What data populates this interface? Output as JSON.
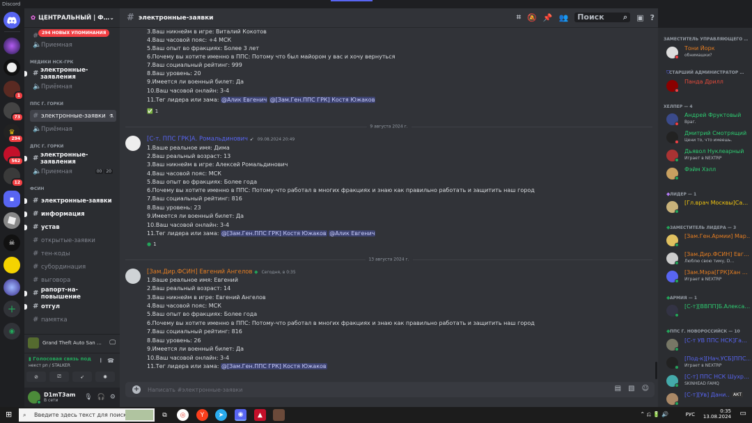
{
  "app": {
    "title": "Discord"
  },
  "guilds": [
    {
      "badge": ""
    },
    {
      "badge": ""
    },
    {
      "badge": ""
    },
    {
      "badge": "1"
    },
    {
      "badge": "73"
    },
    {
      "badge": "294"
    },
    {
      "badge": "562"
    },
    {
      "badge": "12"
    }
  ],
  "server": {
    "name": "ЦЕНТРАЛЬНЫЙ | Ф…",
    "mentions": "294 НОВЫХ УПОМИНАНИЯ"
  },
  "channels": {
    "priemnaya1": "Приемная",
    "cat_medics": "МЕДИКИ НСК-ГРК",
    "med_apps": "электронные-заявления",
    "med_priem": "Приёмная",
    "cat_pps": "ППС Г. ГОРКИ",
    "pps_apps": "электронные-заявки",
    "pps_priem": "Приёмная",
    "cat_dps": "ДПС Г. ГОРКИ",
    "dps_apps": "электронные-заявления",
    "dps_priem": "Приемная",
    "dps_vc": [
      "00",
      "20"
    ],
    "cat_fsin": "ФСИН",
    "fsin_list": [
      "электронные-заявки",
      "информация",
      "устав",
      "открытые-заявки",
      "тен-коды",
      "субординация",
      "выговора",
      "рапорт-на-повышение",
      "отгул",
      "памятка"
    ]
  },
  "activity": {
    "game": "Grand Theft Auto San …"
  },
  "voice": {
    "status": "Голосовая связь под",
    "channel": "некст рп / STALKER"
  },
  "user": {
    "name": "D1mT3am",
    "status": "В сети"
  },
  "topbar": {
    "channel": "электронные-заявки",
    "search_placeholder": "Поиск"
  },
  "messages": [
    {
      "lines": [
        "3.Ваш никнейм в игре:  Виталий Кокотов",
        "4.Ваш часовой пояс:  +4 МСК",
        "5.Ваш опыт во фракциях:  Более 3 лет",
        "6.Почему вы хотите именно в ППС: Потому что был майором у вас и хочу вернуться",
        "7.Ваш социальный рейтинг:  999",
        "8.Ваш уровень: 20",
        "9.Имеется ли военный билет:  Да",
        "10.Ваш часовой онлайн: 3-4"
      ],
      "tag_prefix": "11.Тег лидера или зама: ",
      "tags": [
        "@Алик Евгенич",
        "@[Зам.Ген.ППС ГРК] Костя Южаков"
      ],
      "reaction": "✅",
      "reaction_count": "1"
    },
    {
      "divider": "9 августа 2024 г.",
      "author": "[С-т. ППС ГРК]А. Ромальдинович",
      "time": "09.08.2024 20:49",
      "lines": [
        "1.Ваше реальное имя: Дима",
        "2.Ваш реальный возраст:  13",
        "3.Ваш никнейм в игре:  Алексей Ромальдинович",
        "4.Ваш часовой пояс:  МСК",
        "5.Ваш опыт во фракциях:  Более  года",
        "6.Почему вы хотите именно в ППС: Потому-что работал в многих фракциях и знаю как правильно работать и защитить наш город",
        "7.Ваш социальный рейтинг:  816",
        "8.Ваш уровень: 23",
        "9.Имеется ли военный билет:  Да",
        "10.Ваш часовой онлайн: 3-4"
      ],
      "tag_prefix": "11.Тег лидера или зама: ",
      "tags": [
        "@[Зам.Ген.ППС ГРК] Костя Южаков",
        "@Алик Евгенич"
      ],
      "reaction": "✅",
      "reaction_count": "1"
    },
    {
      "divider": "13 августа 2024 г.",
      "author": "[Зам.Дир.ФСИН] Евгений Ангелов",
      "time": "Сегодня, в 0:35",
      "lines": [
        "1.Ваше реальное имя: Евгений",
        "2.Ваш реальный возраст:  14",
        "3.Ваш никнейм в игре:  Евгений Ангелов",
        "4.Ваш часовой пояс:  МСК",
        "5.Ваш опыт во фракциях:  Более  года",
        "6.Почему вы хотите именно в ППС: Потому-что работал в многих фракциях и знаю как правильно работать и защитить наш город",
        "7.Ваш социальный рейтинг:  816",
        "8.Ваш уровень: 26",
        "9.Имеется ли военный билет:  Да",
        "10.Ваш часовой онлайн: 3-4"
      ],
      "tag_prefix": "11.Тег лидера или зама: ",
      "tags": [
        "@[Зам.Ген.ППС ГРК] Костя Южаков"
      ]
    }
  ],
  "input": {
    "placeholder": "Написать #электронные-заявки"
  },
  "members": {
    "cats": [
      "ЗАМЕСТИТЕЛЬ УПРАВЛЯЮЩЕГО …",
      "СТАРШИЙ АДМИНИСТРАТОР …",
      "ХЕЛПЕР — 4",
      "ЛИДЕР — 1",
      "ЗАМЕСТИТЕЛЬ ЛИДЕРА — 3",
      "АРМИЯ — 1",
      "ППС Г. НОВОРОССИЙСК — 10"
    ],
    "list": [
      {
        "name": "Тони Йорк",
        "sub": "обнимашки?",
        "color": "#e67e22"
      },
      {
        "name": "Панда Дрилл",
        "sub": "",
        "color": "#e74c3c"
      },
      {
        "name": "Андрей Фруктовый",
        "sub": "Враг.",
        "color": "#2ecc71"
      },
      {
        "name": "Дмитрий Смотрящий",
        "sub": "Цени то, что имеешь.",
        "color": "#2ecc71"
      },
      {
        "name": "Дьявол Нуклеарный",
        "sub": "Играет в NEXTRP",
        "color": "#2ecc71"
      },
      {
        "name": "Фэйм Хэлл",
        "sub": "",
        "color": "#2ecc71"
      },
      {
        "name": "[Гл.врач Москвы]Са…",
        "sub": "",
        "color": "#f1c40f"
      },
      {
        "name": "[Зам.Ген.Армии] Мар…",
        "sub": "",
        "color": "#e67e22"
      },
      {
        "name": "[Зам.Дир.ФСИН] Евг…",
        "sub": "Люблю свою тиму, D…",
        "color": "#e67e22"
      },
      {
        "name": "[Зам.Мэра[ГРК]Хан …",
        "sub": "Играет в NEXTRP",
        "color": "#e67e22"
      },
      {
        "name": "[С-т][ВВПП]Б.Алекса…",
        "sub": "",
        "color": "#2ecc71"
      },
      {
        "name": "[С-т УВ ППС НСК]Га…",
        "sub": "",
        "color": "#5865f2"
      },
      {
        "name": "[Под-к][Нач.УСБ]ППС…",
        "sub": "Играет в NEXTRP",
        "color": "#5865f2"
      },
      {
        "name": "[С-т] ППС НСК Шухр…",
        "sub": "SKINHEAD FAMQ",
        "color": "#5865f2"
      },
      {
        "name": "[С-т][Ув] Дани…",
        "sub": "",
        "color": "#5865f2",
        "badge": "АКТ"
      }
    ]
  },
  "taskbar": {
    "search": "Введите здесь текст для поиска",
    "lang": "РУС",
    "time": "0:35",
    "date": "13.08.2024"
  }
}
